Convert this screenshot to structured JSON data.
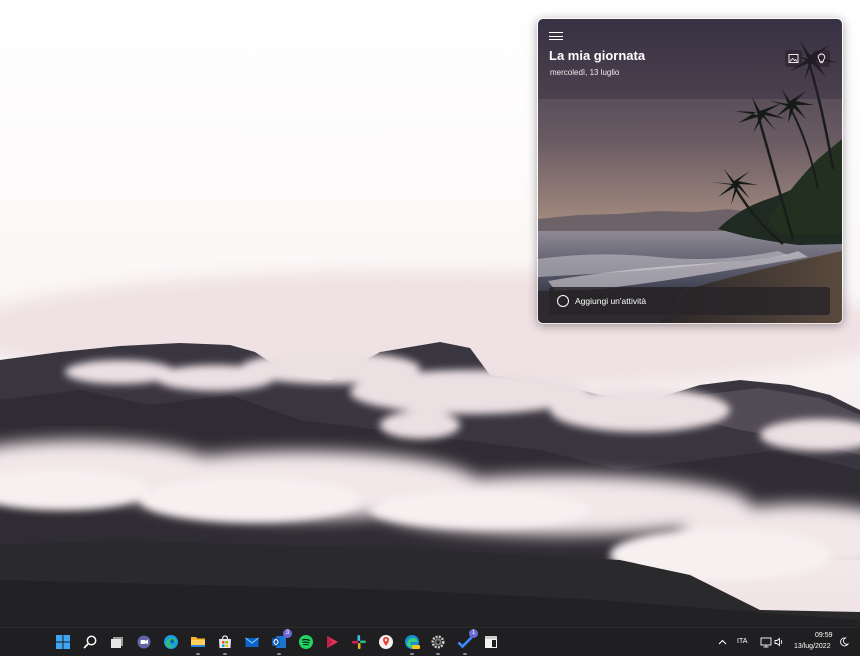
{
  "widget": {
    "title": "La mia giornata",
    "date": "mercoledì, 13 luglio",
    "add_task_label": "Aggiungi un'attività",
    "icons": [
      "menu-icon",
      "change-background-icon",
      "suggestions-lightbulb-icon",
      "task-circle-icon"
    ]
  },
  "taskbar": {
    "apps": [
      {
        "name": "start",
        "icon": "windows-start-icon"
      },
      {
        "name": "search",
        "icon": "search-icon"
      },
      {
        "name": "task-view",
        "icon": "task-view-icon"
      },
      {
        "name": "teams-chat",
        "icon": "chat-icon"
      },
      {
        "name": "edge",
        "icon": "edge-icon"
      },
      {
        "name": "file-explorer",
        "icon": "folder-icon"
      },
      {
        "name": "store",
        "icon": "store-icon"
      },
      {
        "name": "mail",
        "icon": "mail-icon"
      },
      {
        "name": "outlook",
        "icon": "outlook-icon",
        "badge": "3"
      },
      {
        "name": "spotify",
        "icon": "spotify-icon"
      },
      {
        "name": "media-player",
        "icon": "play-icon"
      },
      {
        "name": "slack",
        "icon": "slack-icon"
      },
      {
        "name": "maps",
        "icon": "maps-pin-icon"
      },
      {
        "name": "edge-canary",
        "icon": "edge-canary-icon"
      },
      {
        "name": "settings",
        "icon": "gear-icon"
      },
      {
        "name": "todo",
        "icon": "todo-check-icon",
        "badge": "1"
      },
      {
        "name": "snipping",
        "icon": "app-window-icon"
      }
    ],
    "tray": {
      "language": "ITA",
      "time": "09:59",
      "date": "13/lug/2022"
    }
  },
  "colors": {
    "taskbar_bg": "#1f1f22",
    "accent": "#0078d4"
  }
}
